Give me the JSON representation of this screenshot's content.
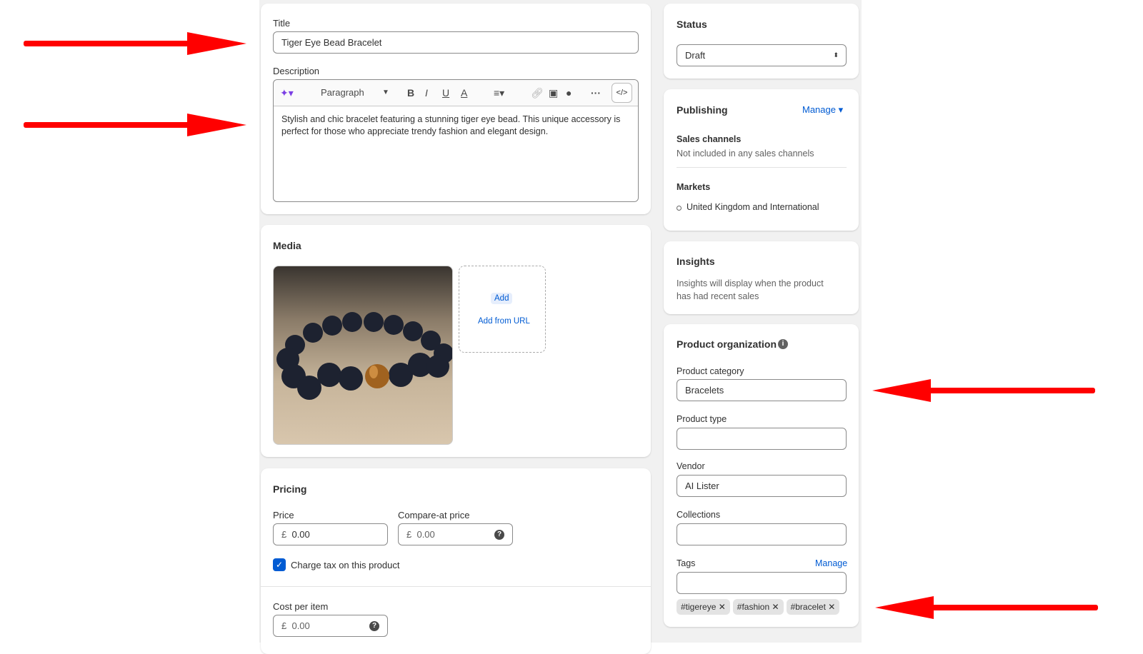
{
  "title_card": {
    "title_label": "Title",
    "title_value": "Tiger Eye Bead Bracelet",
    "description_label": "Description",
    "toolbar": {
      "format": "Paragraph",
      "bold": "B",
      "italic": "I",
      "underline": "U",
      "color": "A"
    },
    "description": "Stylish and chic bracelet featuring a stunning tiger eye bead. This unique accessory is perfect for those who appreciate trendy fashion and elegant design."
  },
  "media": {
    "heading": "Media",
    "add": "Add",
    "add_from_url": "Add from URL"
  },
  "pricing": {
    "heading": "Pricing",
    "price_label": "Price",
    "price_currency": "£",
    "price_value": "0.00",
    "compare_label": "Compare-at price",
    "compare_currency": "£",
    "compare_value": "0.00",
    "charge_tax": "Charge tax on this product",
    "charge_tax_checked": true,
    "cost_label": "Cost per item",
    "cost_currency": "£",
    "cost_value": "0.00"
  },
  "status": {
    "heading": "Status",
    "value": "Draft"
  },
  "publishing": {
    "heading": "Publishing",
    "manage": "Manage",
    "sales_channels_label": "Sales channels",
    "sales_channels_value": "Not included in any sales channels",
    "markets_label": "Markets",
    "markets_value": "United Kingdom and International"
  },
  "insights": {
    "heading": "Insights",
    "text": "Insights will display when the product has had recent sales"
  },
  "organization": {
    "heading": "Product organization",
    "category_label": "Product category",
    "category_value": "Bracelets",
    "type_label": "Product type",
    "type_value": "",
    "vendor_label": "Vendor",
    "vendor_value": "AI Lister",
    "collections_label": "Collections",
    "collections_value": "",
    "tags_label": "Tags",
    "tags_manage": "Manage",
    "tags": [
      "#tigereye",
      "#fashion",
      "#bracelet"
    ]
  },
  "colors": {
    "annotation_arrow": "#ff0000",
    "accent": "#005bd3"
  }
}
